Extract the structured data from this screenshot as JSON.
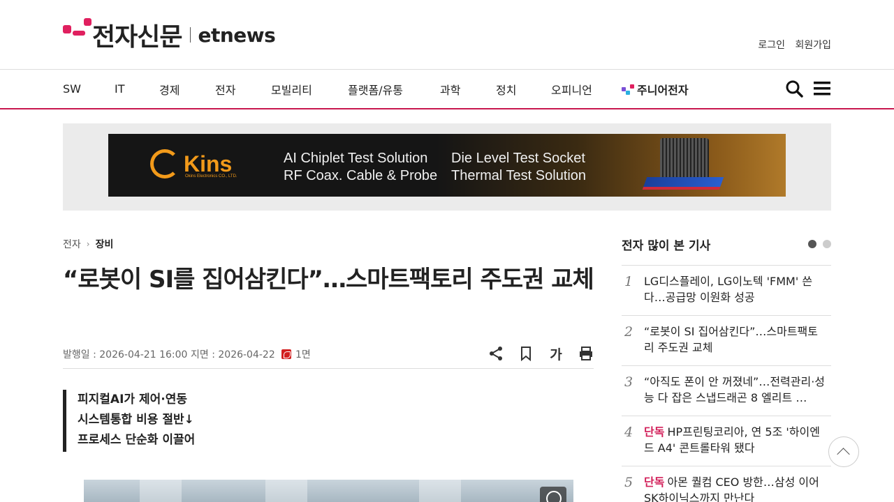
{
  "header": {
    "logo_ko": "전자신문",
    "logo_en": "etnews",
    "login": "로그인",
    "signup": "회원가입",
    "brand_color": "#e0205f"
  },
  "nav": {
    "items": [
      "SW",
      "IT",
      "경제",
      "전자",
      "모빌리티",
      "플랫폼/유통",
      "과학",
      "정치",
      "오피니언"
    ],
    "junior": "주니어전자",
    "search_icon": "search-icon",
    "menu_icon": "hamburger-menu-icon",
    "accent_color": "#c8174f"
  },
  "banner": {
    "brand": "Kins",
    "brand_sub": "Okins Electronics CO., LTD.",
    "line1a": "AI Chiplet Test Solution",
    "line1b": "RF Coax. Cable & Probe",
    "line2a": "Die Level Test Socket",
    "line2b": "Thermal Test Solution"
  },
  "article": {
    "breadcrumb_parent": "전자",
    "breadcrumb_current": "장비",
    "headline": "“로봇이 SI를 집어삼킨다”…스마트팩토리 주도권 교체",
    "published": "발행일 : 2026-04-21 16:00",
    "print_date": "지면 : 2026-04-22",
    "page": "1면",
    "font_size_label": "가",
    "summary": [
      "피지컬AI가 제어·연동",
      "시스템통합 비용 절반↓",
      "프로세스 단순화 이끌어"
    ]
  },
  "sidebar": {
    "title": "전자 많이 본 기사",
    "exclusive_label": "단독",
    "items": [
      {
        "num": "1",
        "text": "LG디스플레이, LG이노텍 'FMM' 쓴다…공급망 이원화 성공"
      },
      {
        "num": "2",
        "text": "“로봇이 SI 집어삼킨다”…스마트팩토리 주도권 교체"
      },
      {
        "num": "3",
        "text": "“아직도 폰이 안 꺼졌네”…전력관리·성능 다 잡은 스냅드래곤 8 엘리트 …"
      },
      {
        "num": "4",
        "text": "HP프린팅코리아, 연 5조 '하이엔드 A4' 콘트롤타워 됐다"
      },
      {
        "num": "5",
        "text": "아몬 퀄컴 CEO 방한…삼성 이어 SK하이닉스까지 만난다"
      }
    ]
  }
}
